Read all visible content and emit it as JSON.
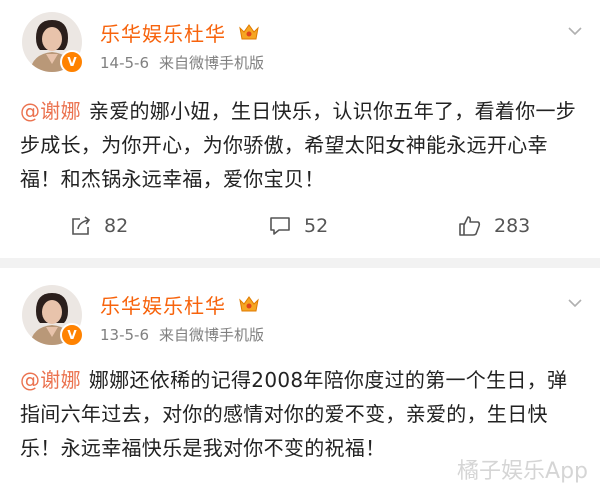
{
  "colors": {
    "username": "#f7630c",
    "mention": "#eb7350",
    "meta": "#808080",
    "verified": "#ff8200"
  },
  "posts": [
    {
      "username": "乐华娱乐杜华",
      "date": "14-5-6",
      "source": "来自微博手机版",
      "mention": "@谢娜",
      "text": "亲爱的娜小妞，生日快乐，认识你五年了，看着你一步步成长，为你开心，为你骄傲，希望太阳女神能永远开心幸福！和杰锅永远幸福，爱你宝贝！",
      "reposts": "82",
      "comments": "52",
      "likes": "283"
    },
    {
      "username": "乐华娱乐杜华",
      "date": "13-5-6",
      "source": "来自微博手机版",
      "mention": "@谢娜",
      "text": "娜娜还依稀的记得2008年陪你度过的第一个生日，弹指间六年过去，对你的感情对你的爱不变，亲爱的，生日快乐！永远幸福快乐是我对你不变的祝福！"
    }
  ],
  "icons": {
    "verified": "V"
  },
  "watermark": "橘子娱乐App"
}
